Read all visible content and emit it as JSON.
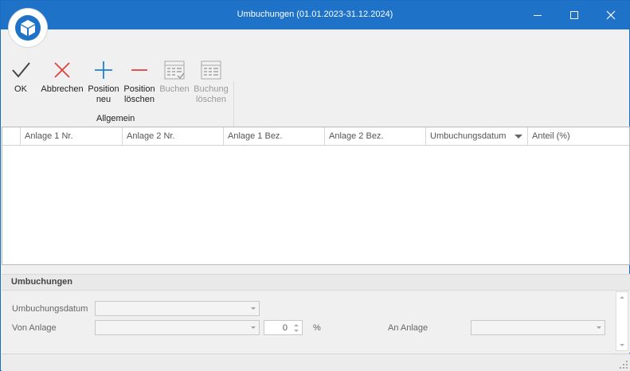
{
  "window": {
    "title": "Umbuchungen (01.01.2023-31.12.2024)",
    "accent_color": "#1e72c8",
    "app_icon": "cube-icon",
    "controls": [
      "minimize-icon",
      "maximize-icon",
      "close-icon"
    ]
  },
  "ribbon": {
    "buttons": [
      {
        "label": "OK",
        "icon": "checkmark-icon",
        "enabled": true
      },
      {
        "label": "Abbrechen",
        "icon": "cross-icon",
        "enabled": true
      },
      {
        "label": "Position\nneu",
        "icon": "plus-icon",
        "enabled": true
      },
      {
        "label": "Position\nlöschen",
        "icon": "minus-icon",
        "enabled": true
      },
      {
        "label": "Buchen",
        "icon": "ledger-book-icon",
        "enabled": false
      },
      {
        "label": "Buchung\nlöschen",
        "icon": "ledger-delete-icon",
        "enabled": false
      }
    ],
    "group_label": "Allgemein"
  },
  "grid": {
    "columns": [
      "Anlage 1 Nr.",
      "Anlage 2 Nr.",
      "Anlage 1 Bez.",
      "Anlage 2 Bez.",
      "Umbuchungsdatum",
      "Anteil (%)"
    ],
    "sorted_column": "Umbuchungsdatum",
    "rows": []
  },
  "form": {
    "title": "Umbuchungen",
    "umbuchungsdatum_label": "Umbuchungsdatum",
    "umbuchungsdatum_value": "",
    "von_anlage_label": "Von Anlage",
    "von_anlage_value": "",
    "anteil_value": "0",
    "percent_sign": "%",
    "an_anlage_label": "An Anlage",
    "an_anlage_value": ""
  }
}
